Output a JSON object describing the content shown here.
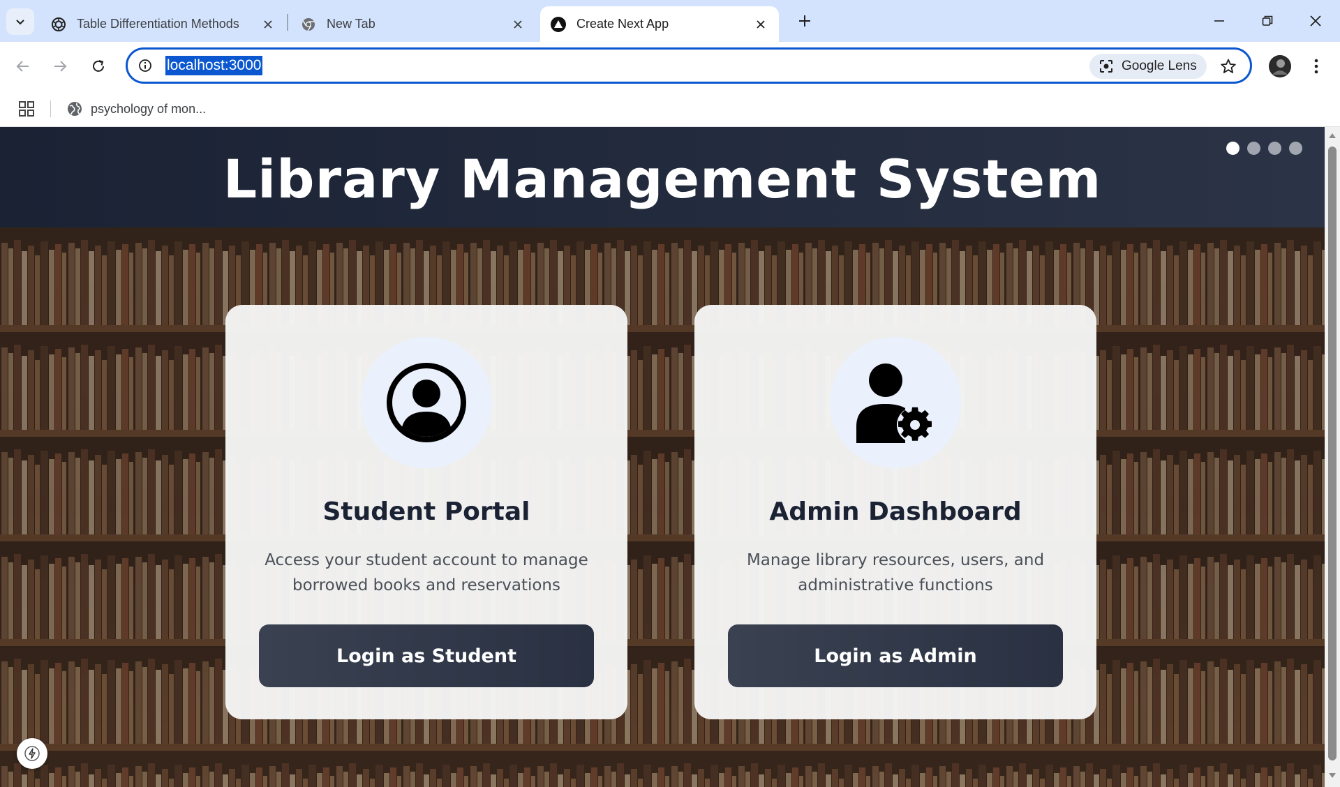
{
  "browser": {
    "tabs": [
      {
        "title": "Table Differentiation Methods",
        "favicon": "openai-icon",
        "active": false
      },
      {
        "title": "New Tab",
        "favicon": "chrome-icon",
        "active": false
      },
      {
        "title": "Create Next App",
        "favicon": "nextjs-icon",
        "active": true
      }
    ],
    "address": {
      "url": "localhost:3000",
      "lens_label": "Google Lens"
    },
    "bookmarks": [
      {
        "label": "psychology of mon..."
      }
    ]
  },
  "page": {
    "title": "Library Management System",
    "carousel_dots": 4,
    "active_dot": 0,
    "cards": [
      {
        "icon": "user-circle-icon",
        "title": "Student Portal",
        "description": "Access your student account to manage borrowed books and reservations",
        "button": "Login as Student"
      },
      {
        "icon": "user-gear-icon",
        "title": "Admin Dashboard",
        "description": "Manage library resources, users, and administrative functions",
        "button": "Login as Admin"
      }
    ]
  },
  "colors": {
    "header": "#1f2737",
    "button": "#323a4a",
    "omnibox_border": "#0b57d0",
    "tabstrip": "#d3e3fd"
  }
}
